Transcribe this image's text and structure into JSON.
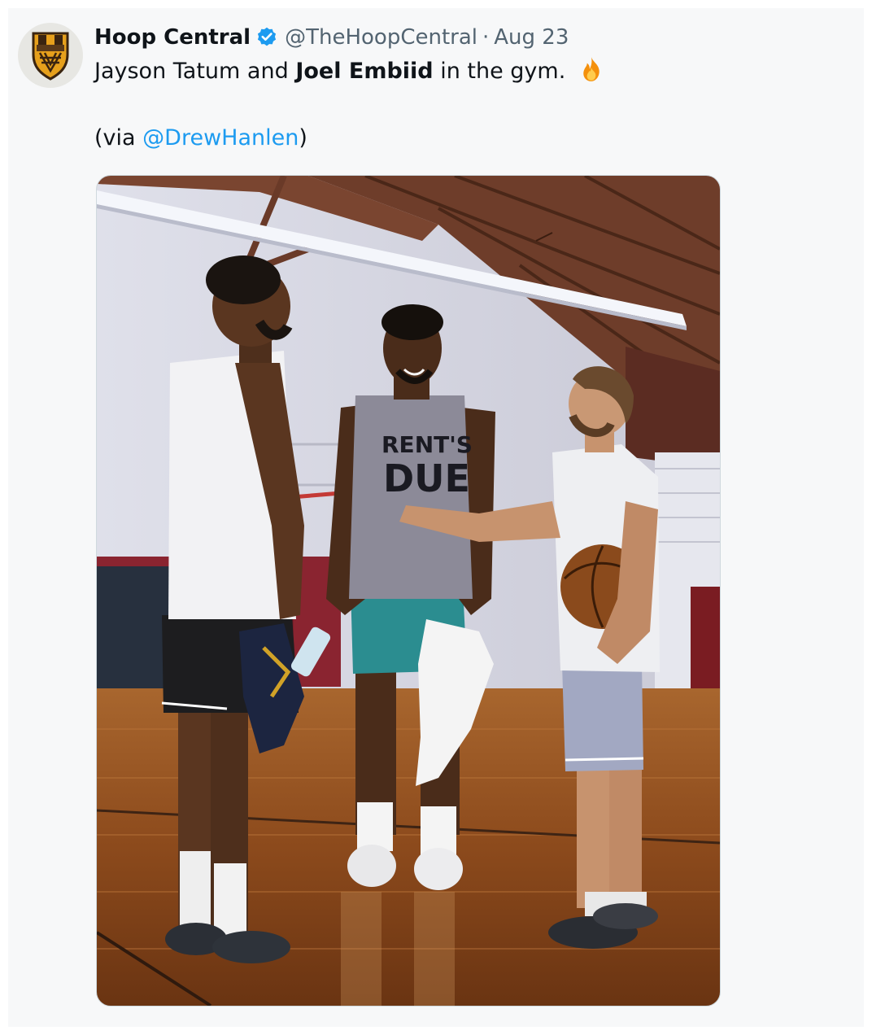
{
  "tweet": {
    "display_name": "Hoop Central",
    "handle": "@TheHoopCentral",
    "separator": "·",
    "date": "Aug 23",
    "text_part1": "Jayson Tatum and ",
    "text_bold": "Joel Embiid",
    "text_part2": " in the gym.",
    "emoji_icon": "fire-icon",
    "via_prefix": "(via ",
    "via_mention": "@DrewHanlen",
    "via_suffix": ")",
    "jersey_text_line1": "RENT'S",
    "jersey_text_line2": "DUE"
  },
  "colors": {
    "text_primary": "#0f1419",
    "text_secondary": "#536471",
    "link": "#1d9bf0",
    "verified": "#1d9bf0",
    "card_background": "#f7f8f9"
  },
  "icons": {
    "avatar": "hoop-central-logo",
    "verified": "verified-badge-icon",
    "emoji": "fire-icon"
  }
}
